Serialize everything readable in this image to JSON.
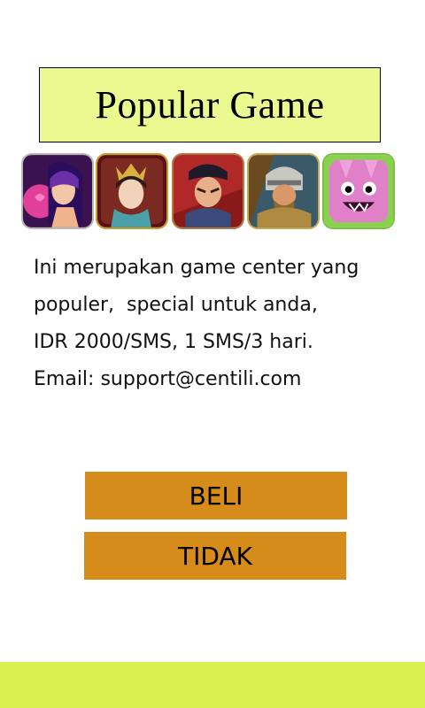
{
  "header": {
    "title": "Popular Game"
  },
  "games": [
    {
      "icon": "pink-haired-heroine-game-icon"
    },
    {
      "icon": "crowned-princess-game-icon"
    },
    {
      "icon": "hero-warrior-game-icon"
    },
    {
      "icon": "armored-knight-game-icon"
    },
    {
      "icon": "pink-monster-game-icon"
    }
  ],
  "description": {
    "line1": "Ini merupakan game center yang",
    "line2": "populer,  special untuk anda,",
    "line3": "IDR 2000/SMS, 1 SMS/3 hari.",
    "line4": "Email: support@centili.com"
  },
  "actions": {
    "buy_label": "BELI",
    "decline_label": "TIDAK"
  },
  "colors": {
    "title_bg": "#eaf990",
    "button_bg": "#d68c1a",
    "footer_bg": "#d8f050"
  }
}
